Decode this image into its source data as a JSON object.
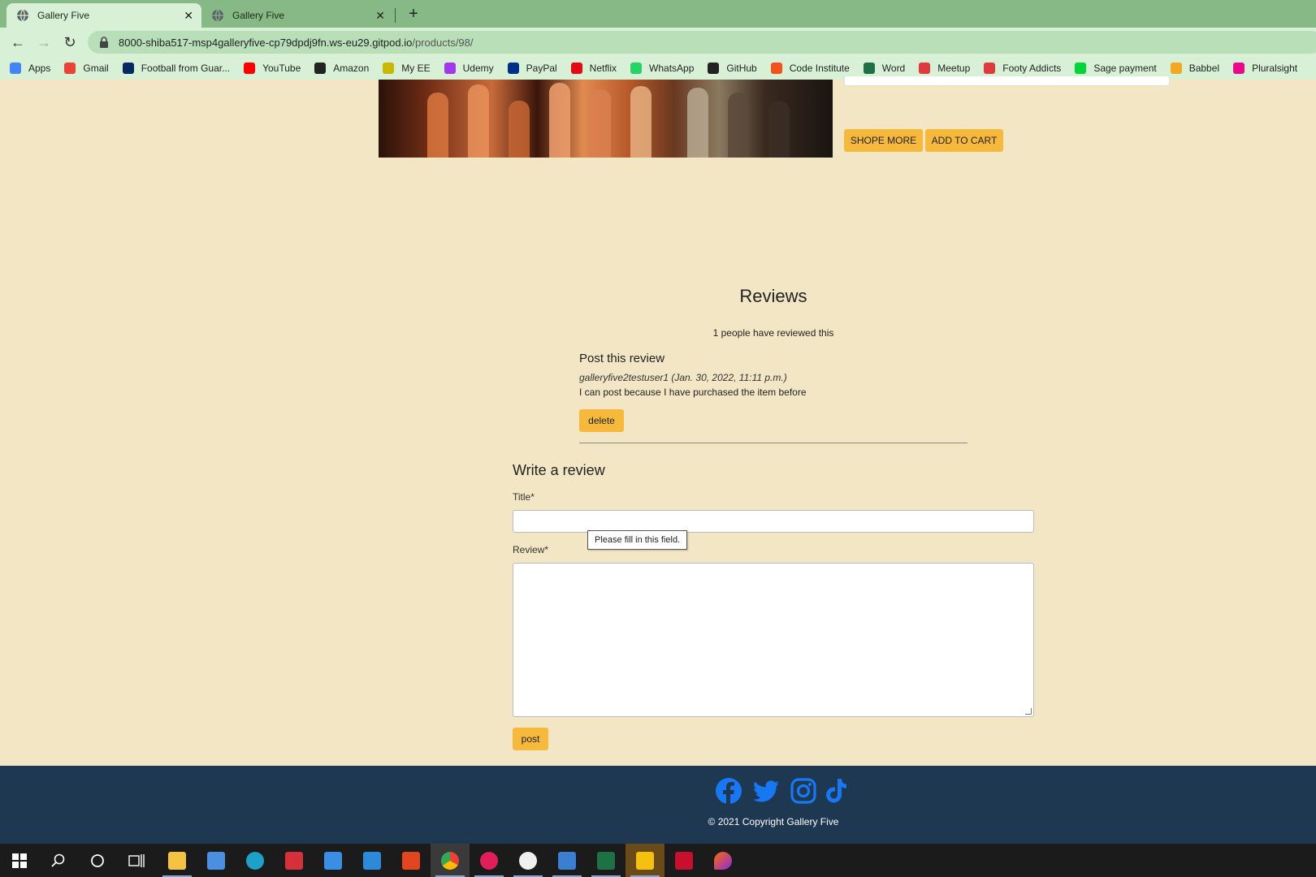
{
  "browser": {
    "tabs": [
      {
        "title": "Gallery Five",
        "active": true
      },
      {
        "title": "Gallery Five",
        "active": false
      }
    ],
    "url_main": "8000-shiba517-msp4galleryfive-cp79dpdj9fn.ws-eu29.gitpod.io",
    "url_path": "/products/98/",
    "bookmarks": [
      {
        "label": "Apps",
        "icon": "apps-grid-icon",
        "color": "#4285f4"
      },
      {
        "label": "Gmail",
        "icon": "gmail-icon",
        "color": "#ea4335"
      },
      {
        "label": "Football from Guar...",
        "icon": "guardian-icon",
        "color": "#052962"
      },
      {
        "label": "YouTube",
        "icon": "youtube-icon",
        "color": "#ff0000"
      },
      {
        "label": "Amazon",
        "icon": "amazon-icon",
        "color": "#222222"
      },
      {
        "label": "My EE",
        "icon": "ee-icon",
        "color": "#c8b900"
      },
      {
        "label": "Udemy",
        "icon": "udemy-icon",
        "color": "#a435f0"
      },
      {
        "label": "PayPal",
        "icon": "paypal-icon",
        "color": "#003087"
      },
      {
        "label": "Netflix",
        "icon": "netflix-icon",
        "color": "#e50914"
      },
      {
        "label": "WhatsApp",
        "icon": "whatsapp-icon",
        "color": "#25d366"
      },
      {
        "label": "GitHub",
        "icon": "github-icon",
        "color": "#222222"
      },
      {
        "label": "Code Institute",
        "icon": "code-institute-icon",
        "color": "#f4511e"
      },
      {
        "label": "Word",
        "icon": "word-icon",
        "color": "#1e7145"
      },
      {
        "label": "Meetup",
        "icon": "meetup-icon",
        "color": "#e0393e"
      },
      {
        "label": "Footy Addicts",
        "icon": "footy-addicts-icon",
        "color": "#e0393e"
      },
      {
        "label": "Sage payment",
        "icon": "sage-icon",
        "color": "#00d639"
      },
      {
        "label": "Babbel",
        "icon": "babbel-icon",
        "color": "#f5a623"
      },
      {
        "label": "Pluralsight",
        "icon": "pluralsight-icon",
        "color": "#e80a89"
      }
    ]
  },
  "product": {
    "shop_more_label": "SHOPE MORE",
    "add_to_cart_label": "ADD TO CART"
  },
  "reviews": {
    "heading": "Reviews",
    "count_text": "1 people have reviewed this",
    "items": [
      {
        "title": "Post this review",
        "meta": "galleryfive2testuser1 (Jan. 30, 2022, 11:11 p.m.)",
        "body": "I can post because I have purchased the item before",
        "delete_label": "delete"
      }
    ]
  },
  "form": {
    "heading": "Write a review",
    "title_label": "Title*",
    "review_label": "Review*",
    "validation_tooltip": "Please fill in this field.",
    "post_label": "post"
  },
  "footer": {
    "social_icons": [
      "facebook-icon",
      "twitter-icon",
      "instagram-icon",
      "tiktok-icon"
    ],
    "copyright": "© 2021 Copyright Gallery Five"
  },
  "colors": {
    "page_bg": "#f3e6c5",
    "button_accent": "#f6b93b",
    "footer_bg": "#1e3852",
    "social_icon": "#1877f2",
    "browser_frame": "#86b986"
  }
}
